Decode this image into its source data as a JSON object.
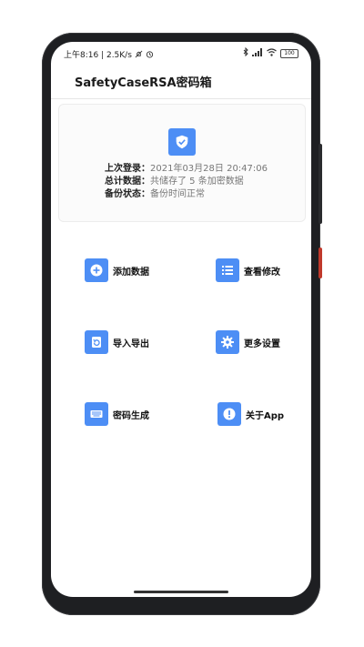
{
  "status_bar": {
    "left_text": "上午8:16 | 2.5K/s",
    "battery": "100",
    "icons": [
      "mute-icon",
      "alarm-icon",
      "bluetooth-icon",
      "signal-icon",
      "wifi-icon",
      "battery-icon"
    ]
  },
  "app": {
    "title": "SafetyCaseRSA密码箱"
  },
  "info_card": {
    "icon": "shield-check-icon",
    "rows": [
      {
        "label": "上次登录：",
        "value": "2021年03月28日 20:47:06"
      },
      {
        "label": "总计数据：",
        "value": "共储存了 5 条加密数据"
      },
      {
        "label": "备份状态：",
        "value": "备份时间正常"
      }
    ]
  },
  "menu": [
    {
      "label": "添加数据",
      "icon": "add-circle-icon"
    },
    {
      "label": "查看修改",
      "icon": "list-icon"
    },
    {
      "label": "导入导出",
      "icon": "import-export-icon"
    },
    {
      "label": "更多设置",
      "icon": "settings-icon"
    },
    {
      "label": "密码生成",
      "icon": "keyboard-icon"
    },
    {
      "label": "关于App",
      "icon": "info-icon"
    }
  ],
  "colors": {
    "accent": "#4d8ef5",
    "frame": "#1e1f22",
    "text": "#111111",
    "muted": "#777777"
  }
}
